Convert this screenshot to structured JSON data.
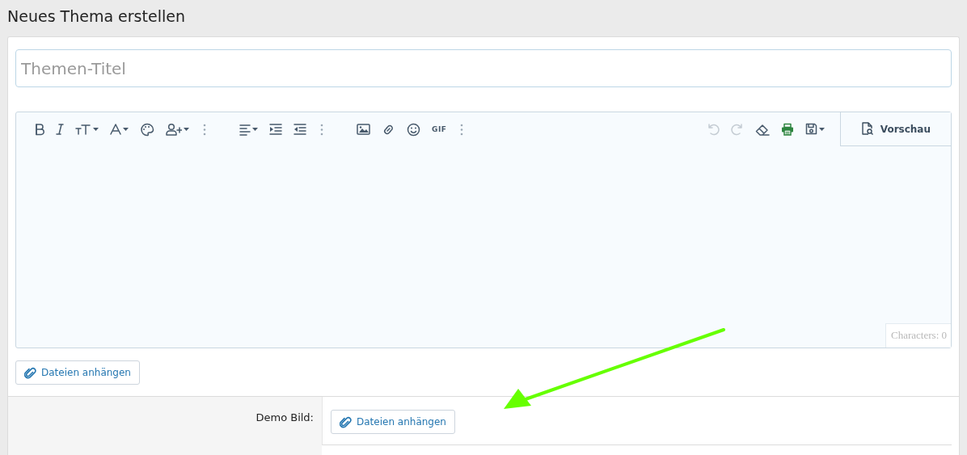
{
  "page_title": "Neues Thema erstellen",
  "title_field": {
    "placeholder": "Themen-Titel"
  },
  "editor": {
    "toolbar_left": [
      {
        "kind": "bold"
      },
      {
        "kind": "italic"
      },
      {
        "kind": "fontsize",
        "dropdown": true
      },
      {
        "kind": "fontcolor",
        "dropdown": true
      },
      {
        "kind": "palette"
      },
      {
        "kind": "mention",
        "dropdown": true
      },
      {
        "kind": "more"
      },
      {
        "kind": "gap"
      },
      {
        "kind": "align",
        "dropdown": true
      },
      {
        "kind": "indent"
      },
      {
        "kind": "outdent"
      },
      {
        "kind": "more"
      },
      {
        "kind": "gap"
      },
      {
        "kind": "image"
      },
      {
        "kind": "link"
      },
      {
        "kind": "smiley"
      },
      {
        "kind": "gif",
        "label": "GIF"
      },
      {
        "kind": "more"
      }
    ],
    "toolbar_right": [
      {
        "kind": "undo",
        "disabled": true
      },
      {
        "kind": "redo",
        "disabled": true
      },
      {
        "kind": "eraser",
        "disabled": false
      },
      {
        "kind": "print",
        "disabled": false
      },
      {
        "kind": "save",
        "dropdown": true,
        "disabled": false
      }
    ],
    "preview_button": "Vorschau",
    "counter": "Characters: 0"
  },
  "attach_button": "Dateien anhängen",
  "fields": [
    {
      "label": "Demo Bild:",
      "button": "Dateien anhängen"
    }
  ],
  "annotation": {
    "kind": "arrow",
    "color": "#66ff00"
  }
}
